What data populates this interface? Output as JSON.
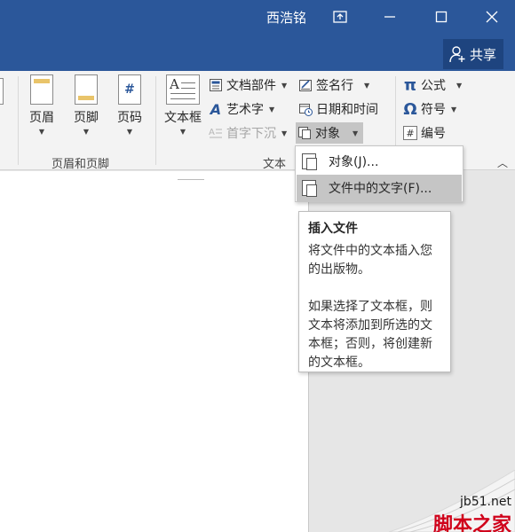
{
  "titlebar": {
    "user_name": "西浩铭",
    "share_label": "共享"
  },
  "ribbon": {
    "header_footer_group": {
      "label": "页眉和页脚",
      "header_label": "页眉",
      "footer_label": "页脚",
      "page_number_label": "页码",
      "page_number_glyph": "#"
    },
    "text_group": {
      "label": "文本",
      "textbox_label": "文本框",
      "quick_parts_label": "文档部件",
      "wordart_label": "艺术字",
      "dropcap_label": "首字下沉",
      "signature_label": "签名行",
      "datetime_label": "日期和时间",
      "object_label": "对象"
    },
    "symbols_group": {
      "equation_label": "公式",
      "symbol_label": "符号",
      "numbering_label": "编号"
    }
  },
  "menu": {
    "items": [
      {
        "label": "对象(J)..."
      },
      {
        "label": "文件中的文字(F)..."
      }
    ]
  },
  "tooltip": {
    "title": "插入文件",
    "para1": "将文件中的文本插入您的出版物。",
    "para2": "如果选择了文本框，则文本将添加到所选的文本框；否则，将创建新的文本框。"
  },
  "watermark": {
    "url": "jb51.net",
    "text": "脚本之家"
  },
  "colors": {
    "titlebar": "#2b579a",
    "share_button": "#1e447f",
    "ribbon": "#f3f3f3",
    "menu_hover": "#c5c5c5",
    "watermark": "#d0021b"
  }
}
